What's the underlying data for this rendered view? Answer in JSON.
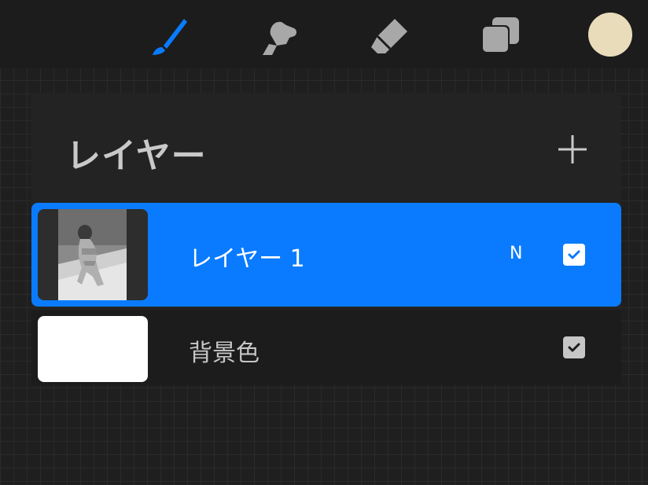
{
  "toolbar": {
    "tools": [
      {
        "name": "brush",
        "icon": "brush-icon",
        "active": true,
        "color": "#0a7bff"
      },
      {
        "name": "smudge",
        "icon": "smudge-icon",
        "active": false,
        "color": "#a8a8a8"
      },
      {
        "name": "eraser",
        "icon": "eraser-icon",
        "active": false,
        "color": "#a8a8a8"
      },
      {
        "name": "layers",
        "icon": "layers-icon",
        "active": false,
        "color": "#a8a8a8"
      }
    ],
    "current_color": "#e8dcbb"
  },
  "layers_panel": {
    "title": "レイヤー",
    "add_icon": "plus-icon",
    "layers": [
      {
        "name": "レイヤー 1",
        "blend_mode": "N",
        "visible": true,
        "selected": true,
        "thumbnail": "photo"
      },
      {
        "name": "背景色",
        "visible": true,
        "selected": false,
        "thumbnail_color": "#ffffff"
      }
    ]
  },
  "colors": {
    "accent": "#0a7bff",
    "panel_bg": "#232323",
    "toolbar_bg": "#1c1c1c",
    "text_muted": "#c6c6c6"
  }
}
